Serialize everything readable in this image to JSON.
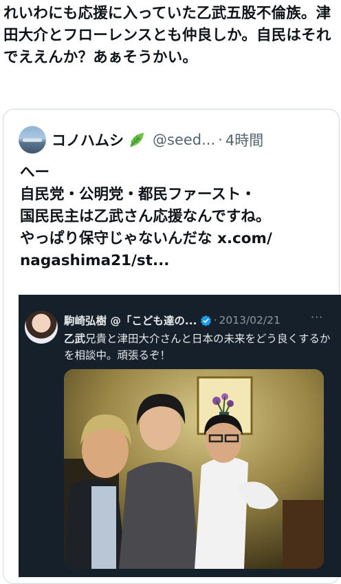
{
  "tweet": {
    "text": "れいわにも応援に入っていた乙武五股不倫族。津田大介とフローレンスとも仲良しか。自民はそれでええんか？あぁそうかい。"
  },
  "quote": {
    "author_name": "コノハムシ",
    "author_badge_icon": "leaf-icon",
    "handle": "@seed...",
    "separator": "·",
    "time": "4時間",
    "body": "へー\n自民党・公明党・都民ファースト・\n国民民主は乙武さん応援なんですね。\nやっぱり保守じゃないんだな x.com/\nnagashima21/st..."
  },
  "embedded": {
    "author_name": "駒崎弘樹 @「こども達の...",
    "verified_icon": "verified-badge-icon",
    "separator": "·",
    "date": "2013/02/21",
    "more_label": "···",
    "text_bold": "乙武",
    "text_rest": "兄貴と津田大介さんと日本の未来をどう良くするかを相談中。頑張るぞ！",
    "photo_icon": "photo-three-men"
  },
  "colors": {
    "text_primary": "#0f1419",
    "text_secondary": "#536471",
    "card_border": "#cfd9de",
    "dark_bg": "#15202b",
    "dark_text": "#e7e9ea",
    "verified_blue": "#1d9bf0"
  }
}
